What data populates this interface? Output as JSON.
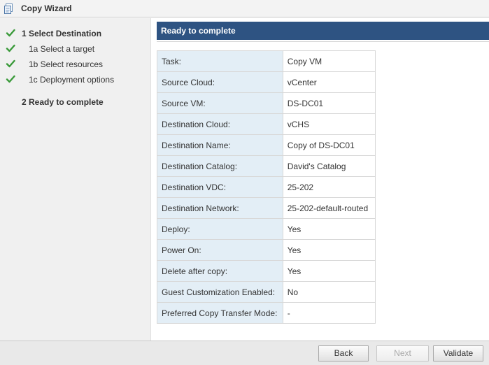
{
  "window": {
    "title": "Copy Wizard",
    "icon": "copy-document-icon"
  },
  "sidebar": {
    "steps": [
      {
        "label": "1 Select Destination",
        "completed": true
      },
      {
        "label": "1a Select a target",
        "completed": true
      },
      {
        "label": "1b Select resources",
        "completed": true
      },
      {
        "label": "1c Deployment options",
        "completed": true
      },
      {
        "label": "2 Ready to complete",
        "completed": false,
        "current": true
      }
    ]
  },
  "main": {
    "header": "Ready to complete",
    "summary": [
      {
        "key": "Task:",
        "value": "Copy VM"
      },
      {
        "key": "Source Cloud:",
        "value": "vCenter"
      },
      {
        "key": "Source VM:",
        "value": "DS-DC01"
      },
      {
        "key": "Destination Cloud:",
        "value": "vCHS"
      },
      {
        "key": "Destination Name:",
        "value": "Copy of DS-DC01"
      },
      {
        "key": "Destination Catalog:",
        "value": "David's Catalog"
      },
      {
        "key": "Destination VDC:",
        "value": "25-202"
      },
      {
        "key": "Destination Network:",
        "value": "25-202-default-routed"
      },
      {
        "key": "Deploy:",
        "value": "Yes"
      },
      {
        "key": "Power On:",
        "value": "Yes"
      },
      {
        "key": "Delete after copy:",
        "value": "Yes"
      },
      {
        "key": "Guest Customization Enabled:",
        "value": "No"
      },
      {
        "key": "Preferred Copy Transfer Mode:",
        "value": "-"
      }
    ]
  },
  "footer": {
    "back_label": "Back",
    "next_label": "Next",
    "next_enabled": false,
    "validate_label": "Validate"
  },
  "colors": {
    "header_bg": "#2e5382",
    "check_green": "#3a9a3a",
    "key_cell_bg": "#e3eef6"
  }
}
